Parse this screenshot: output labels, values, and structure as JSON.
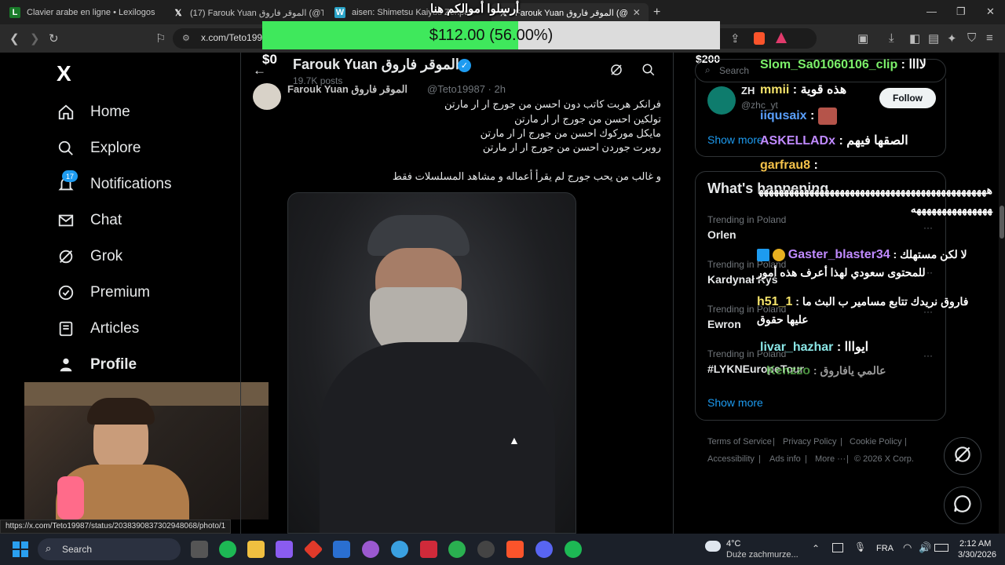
{
  "browser": {
    "tabs": [
      {
        "title": "Clavier arabe en ligne • Lexilogos"
      },
      {
        "title": "(17) Farouk Yuan الموقر فاروق (@Teto"
      },
      {
        "title": "aisen: Shimetsu Kaiyuu Zenpen"
      },
      {
        "title": "Farouk Yuan الموقر فاروق (@"
      }
    ],
    "new_tab": "+",
    "url": "x.com/Teto1998"
  },
  "donation": {
    "amount_text": "$112.00 (56.00%)",
    "progress": 0.56,
    "message": "أرسلوا أموالكم هنا",
    "min_label": "$0",
    "max_label": "$200",
    "colors": {
      "fill": "#3fe85c",
      "empty": "#dcdcdc"
    }
  },
  "sidebar": {
    "logo": "X",
    "items": [
      {
        "label": "Home",
        "icon": "home-icon"
      },
      {
        "label": "Explore",
        "icon": "search-icon"
      },
      {
        "label": "Notifications",
        "icon": "bell-icon",
        "badge": "17"
      },
      {
        "label": "Chat",
        "icon": "mail-icon"
      },
      {
        "label": "Grok",
        "icon": "grok-icon"
      },
      {
        "label": "Premium",
        "icon": "verified-icon"
      },
      {
        "label": "Articles",
        "icon": "article-icon"
      },
      {
        "label": "Profile",
        "icon": "person-icon"
      }
    ]
  },
  "profile_header": {
    "name": "Farouk Yuan الموقر فاروق",
    "posts": "19.7K posts"
  },
  "tweet": {
    "author": "Farouk Yuan الموقر فاروق",
    "handle": "@Teto19987 · 2h",
    "lines": [
      "فرانكر هربت كاتب دون احسن من جورج ار ار مارتن",
      "تولكين احسن من جورج ار ار مارتن",
      "مايكل موركوك احسن من جورج ار ار مارتن",
      "روبرت جوردن احسن من جورج ار ار مارتن",
      "و غالب من يحب جورج لم يقرأ أعماله و مشاهد المسلسلات فقط"
    ]
  },
  "right": {
    "search_placeholder": "Search",
    "who_to_follow": {
      "name": "ZH",
      "handle": "@zhc_yt",
      "follow": "Follow",
      "show_more": "Show more"
    },
    "whats_happening": "What's happening",
    "trends": [
      {
        "context": "Trending in Poland",
        "name": "Orlen"
      },
      {
        "context": "Trending in Poland",
        "name": "Kardynał Ryś"
      },
      {
        "context": "Trending in Poland",
        "name": "Ewron"
      },
      {
        "context": "Trending in Poland",
        "name": "#LYKNEuropeTour"
      }
    ],
    "show_more": "Show more",
    "footer": [
      "Terms of Service",
      "Privacy Policy",
      "Cookie Policy",
      "Accessibility",
      "Ads info",
      "More ···",
      "© 2026 X Corp."
    ]
  },
  "chat": [
    {
      "user": "Slom_Sa01060106_clip",
      "msg": "لاااا",
      "color": "#7cf06a"
    },
    {
      "user": "mmii",
      "msg": "هذه قوية",
      "color": "#f5e36a"
    },
    {
      "user": "iiqusaix",
      "msg": "",
      "color": "#5aa0ff"
    },
    {
      "user": "ASKELLADx",
      "msg": "الصقها فيهم",
      "color": "#c08aff"
    },
    {
      "user": "garfrau8",
      "msg": "",
      "color": "#f5c24a"
    },
    {
      "user": "Gaster_blaster34",
      "msg": "لا لكن مستهلك للمحتوى سعودي لهذا أعرف هذه أمور",
      "color": "#c08aff"
    },
    {
      "user": "h51_1",
      "msg": "فاروق نريدك تتابع مسامير ب البث ما عليها حقوق",
      "color": "#f5e36a"
    },
    {
      "user": "livar_hazhar",
      "msg": "ايوااا",
      "color": "#8ae6e6"
    },
    {
      "user": "Kenzzo",
      "msg": "عالمي يافاروق",
      "color": "#7cf06a"
    }
  ],
  "chat_spam": "هههههههههههههههههههههههههههههههههههههههههههههههههههههههههههههه",
  "statusbar": "https://x.com/Teto19987/status/2038390837302948068/photo/1",
  "taskbar": {
    "search": "Search",
    "weather_temp": "4°C",
    "weather_desc": "Duże zachmurze...",
    "lang": "FRA",
    "time": "2:12 AM",
    "date": "3/30/2026"
  }
}
